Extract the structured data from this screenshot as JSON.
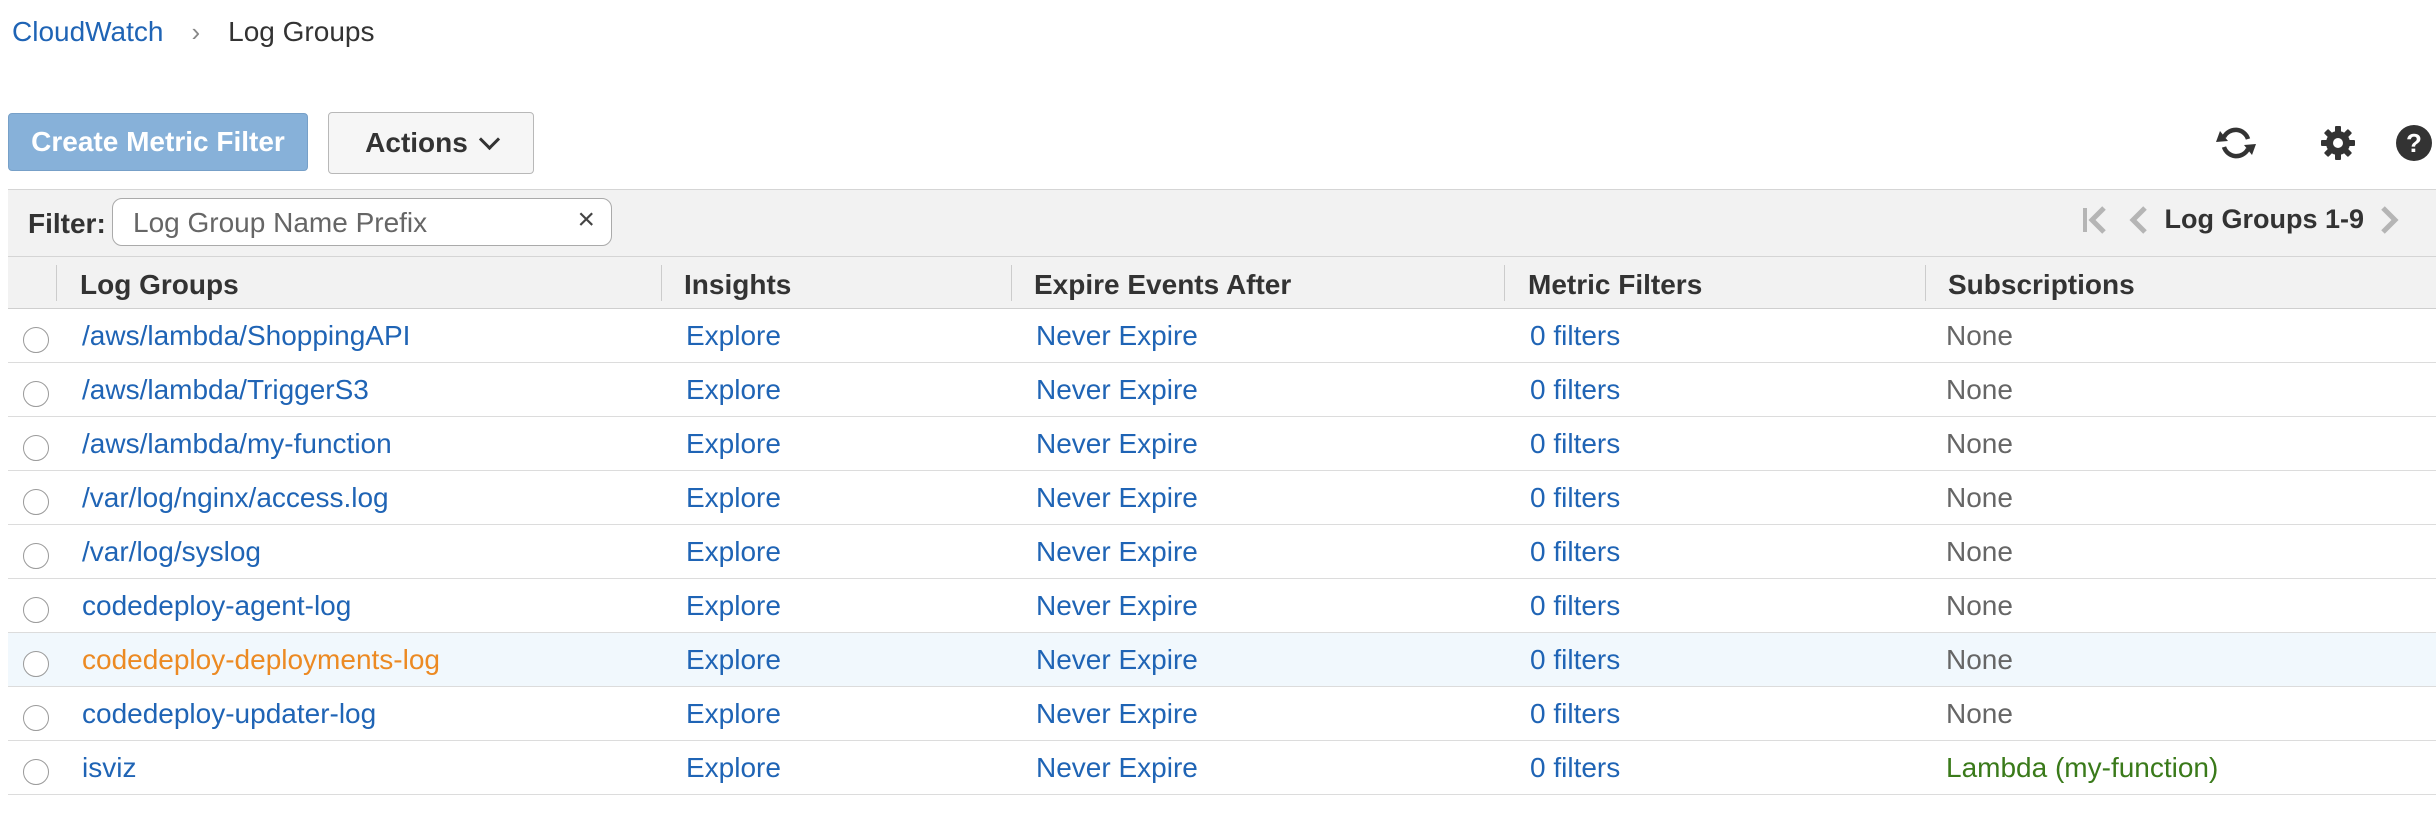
{
  "breadcrumb": {
    "root": "CloudWatch",
    "separator": "›",
    "current": "Log Groups"
  },
  "toolbar": {
    "create_label": "Create Metric Filter",
    "actions_label": "Actions",
    "icons": [
      "refresh-icon",
      "gear-icon",
      "help-icon"
    ]
  },
  "filter": {
    "label": "Filter:",
    "placeholder": "Log Group Name Prefix",
    "value": "",
    "clear": "×",
    "pager_text": "Log Groups 1-9"
  },
  "table": {
    "columns": [
      "Log Groups",
      "Insights",
      "Expire Events After",
      "Metric Filters",
      "Subscriptions"
    ],
    "rows": [
      {
        "name": "/aws/lambda/ShoppingAPI",
        "insights": "Explore",
        "expire": "Never Expire",
        "filters": "0 filters",
        "subscriptions": "None"
      },
      {
        "name": "/aws/lambda/TriggerS3",
        "insights": "Explore",
        "expire": "Never Expire",
        "filters": "0 filters",
        "subscriptions": "None"
      },
      {
        "name": "/aws/lambda/my-function",
        "insights": "Explore",
        "expire": "Never Expire",
        "filters": "0 filters",
        "subscriptions": "None"
      },
      {
        "name": "/var/log/nginx/access.log",
        "insights": "Explore",
        "expire": "Never Expire",
        "filters": "0 filters",
        "subscriptions": "None"
      },
      {
        "name": "/var/log/syslog",
        "insights": "Explore",
        "expire": "Never Expire",
        "filters": "0 filters",
        "subscriptions": "None"
      },
      {
        "name": "codedeploy-agent-log",
        "insights": "Explore",
        "expire": "Never Expire",
        "filters": "0 filters",
        "subscriptions": "None"
      },
      {
        "name": "codedeploy-deployments-log",
        "insights": "Explore",
        "expire": "Never Expire",
        "filters": "0 filters",
        "subscriptions": "None"
      },
      {
        "name": "codedeploy-updater-log",
        "insights": "Explore",
        "expire": "Never Expire",
        "filters": "0 filters",
        "subscriptions": "None"
      },
      {
        "name": "isviz",
        "insights": "Explore",
        "expire": "Never Expire",
        "filters": "0 filters",
        "subscriptions": "Lambda (my-function)"
      }
    ]
  },
  "colors": {
    "link": "#1f64b5",
    "hover_link": "#ec8a23",
    "row_highlight": "#f1f8fd",
    "subscription_active": "#3a7a1a",
    "primary_button": "#87b1d9"
  }
}
